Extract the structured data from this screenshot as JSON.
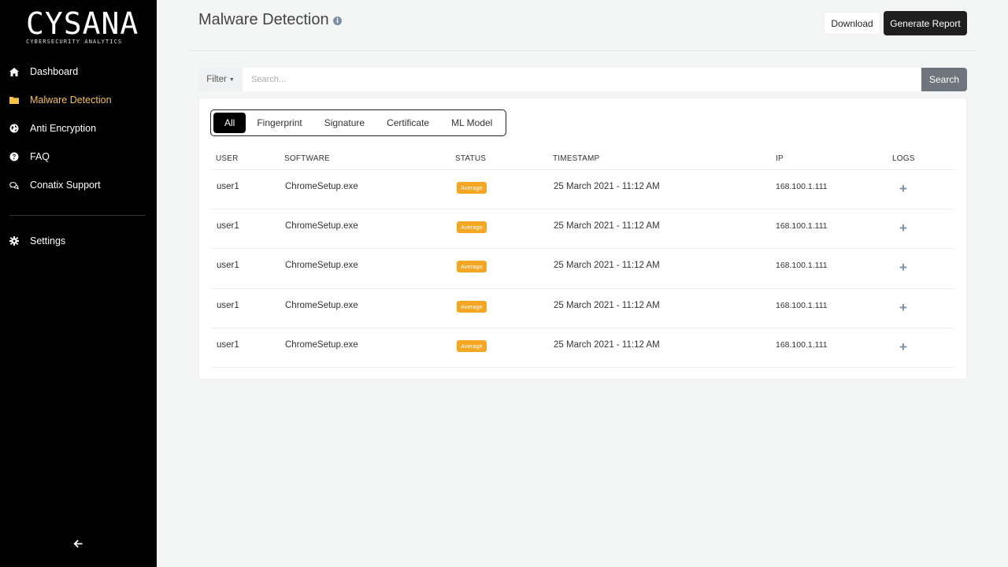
{
  "brand": {
    "name": "CYSANA",
    "tagline": "CYBERSECURITY ANALYTICS"
  },
  "sidebar": {
    "items": [
      {
        "label": "Dashboard",
        "icon": "home-icon",
        "active": false
      },
      {
        "label": "Malware Detection",
        "icon": "folder-icon",
        "active": true
      },
      {
        "label": "Anti Encryption",
        "icon": "globe-icon",
        "active": false
      },
      {
        "label": "FAQ",
        "icon": "question-icon",
        "active": false
      },
      {
        "label": "Conatix Support",
        "icon": "chat-icon",
        "active": false
      }
    ],
    "settings": {
      "label": "Settings",
      "icon": "gear-icon"
    },
    "collapse_icon": "arrow-left-icon"
  },
  "header": {
    "title": "Malware Detection",
    "download_label": "Download",
    "report_label": "Generate Report"
  },
  "search": {
    "filter_label": "Filter",
    "placeholder": "Search...",
    "button_label": "Search"
  },
  "tabs": [
    {
      "label": "All",
      "active": true
    },
    {
      "label": "Fingerprint",
      "active": false
    },
    {
      "label": "Signature",
      "active": false
    },
    {
      "label": "Certificate",
      "active": false
    },
    {
      "label": "ML Model",
      "active": false
    }
  ],
  "table": {
    "columns": [
      "USER",
      "SOFTWARE",
      "STATUS",
      "TIMESTAMP",
      "IP",
      "LOGS"
    ],
    "rows": [
      {
        "user": "user1",
        "software": "ChromeSetup.exe",
        "status": "Average",
        "timestamp": "25 March 2021 - 11:12 AM",
        "ip": "168.100.1.111"
      },
      {
        "user": "user1",
        "software": "ChromeSetup.exe",
        "status": "Average",
        "timestamp": "25 March 2021 - 11:12 AM",
        "ip": "168.100.1.111"
      },
      {
        "user": "user1",
        "software": "ChromeSetup.exe",
        "status": "Average",
        "timestamp": "25 March 2021 - 11:12 AM",
        "ip": "168.100.1.111"
      },
      {
        "user": "user1",
        "software": "ChromeSetup.exe",
        "status": "Average",
        "timestamp": "25 March 2021 - 11:12 AM",
        "ip": "168.100.1.111"
      },
      {
        "user": "user1",
        "software": "ChromeSetup.exe",
        "status": "Average",
        "timestamp": "25 March 2021 - 11:12 AM",
        "ip": "168.100.1.111"
      }
    ]
  },
  "colors": {
    "accent": "#f5c242",
    "status_average": "#f5a623",
    "sidebar_bg": "#000000"
  }
}
